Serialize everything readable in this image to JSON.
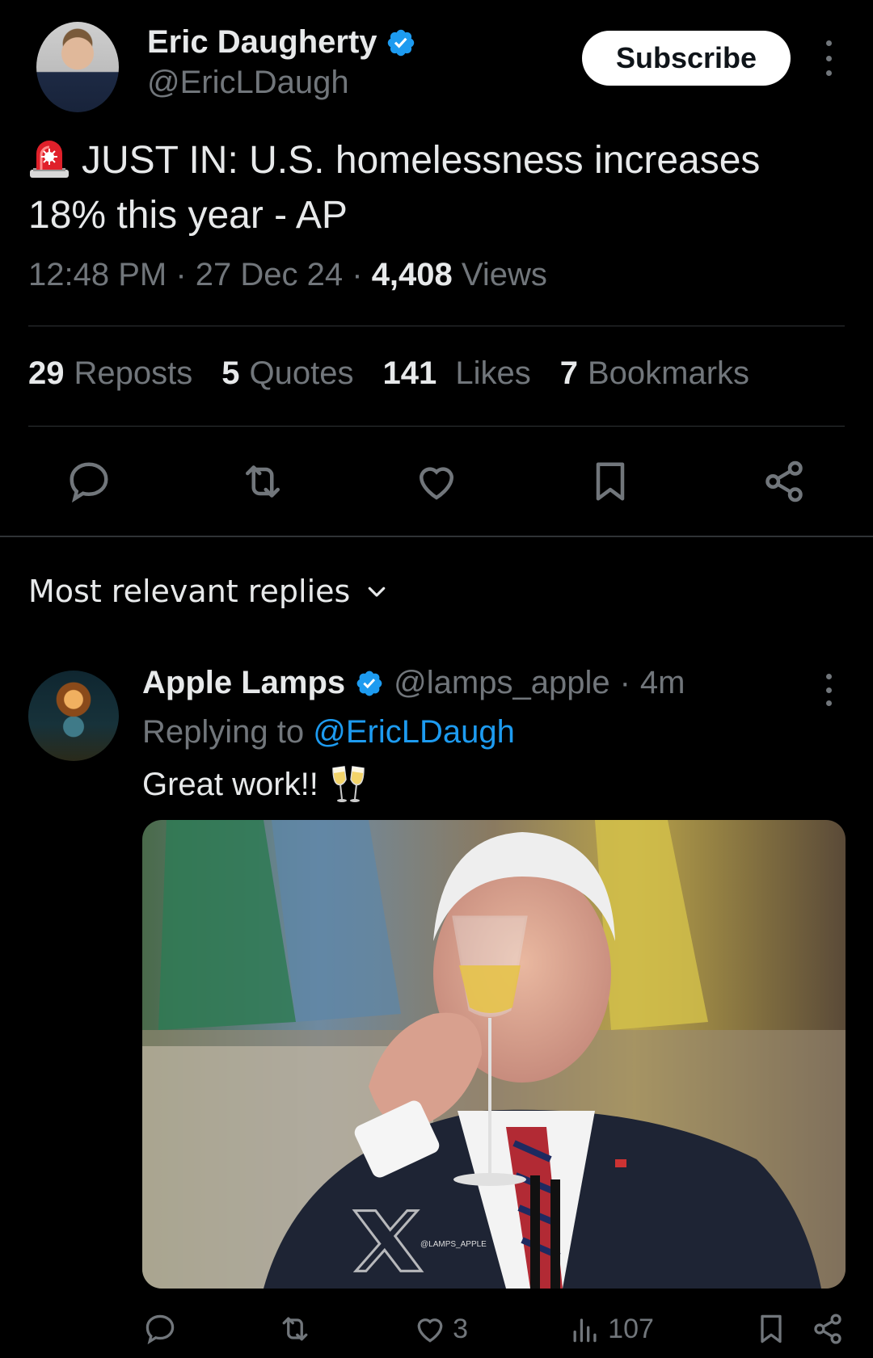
{
  "tweet": {
    "author_name": "Eric Daugherty",
    "author_handle": "@EricLDaugh",
    "subscribe_label": "Subscribe",
    "text": "JUST IN: U.S. homelessness increases 18% this year - AP",
    "time": "12:48 PM",
    "date": "27 Dec 24",
    "views_count": "4,408",
    "views_label": "Views",
    "emoji_icon": "siren-icon",
    "verified_color": "#1d9bf0"
  },
  "stats": [
    {
      "count": "29",
      "label": "Reposts"
    },
    {
      "count": "5",
      "label": "Quotes"
    },
    {
      "count": "141",
      "label": "Likes"
    },
    {
      "count": "7",
      "label": "Bookmarks"
    }
  ],
  "actions": [
    "reply-icon",
    "repost-icon",
    "like-icon",
    "bookmark-icon",
    "share-icon"
  ],
  "replies_sort": {
    "label": "Most relevant replies"
  },
  "reply": {
    "author_name": "Apple Lamps",
    "author_handle": "@lamps_apple",
    "separator": "·",
    "time_ago": "4m",
    "replying_to_prefix": "Replying to",
    "replying_to_handle": "@EricLDaugh",
    "text": "Great work!!",
    "emoji_icon": "clinking-glasses-icon",
    "image_watermark": "@LAMPS_APPLE",
    "likes": "3",
    "views": "107"
  },
  "colors": {
    "background": "#000000",
    "text": "#e7e9ea",
    "muted": "#71767b",
    "link": "#1d9bf0",
    "divider": "#2f3336"
  }
}
